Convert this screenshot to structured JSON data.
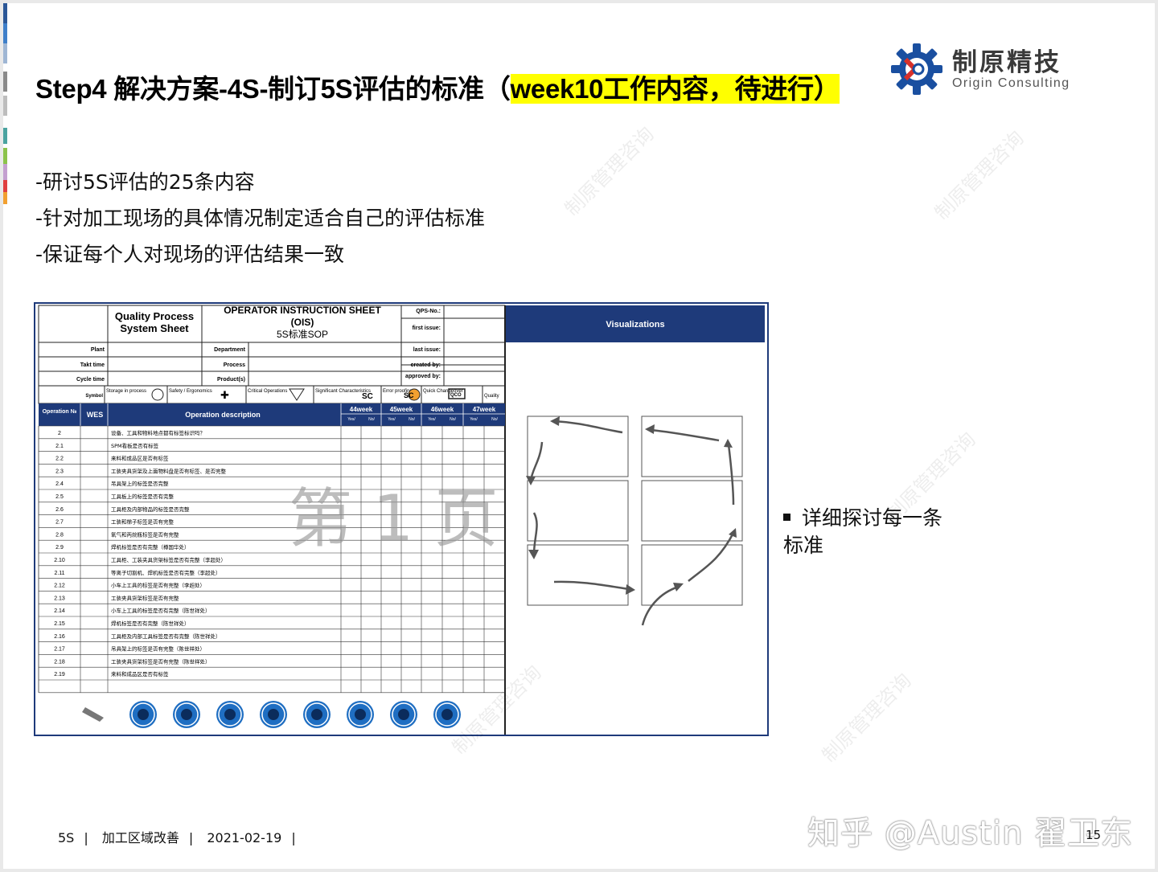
{
  "title": {
    "main": "Step4 解决方案-4S-制订5S评估的标准（",
    "highlight": "week10工作内容，待进行）"
  },
  "logo": {
    "cn": "制原精技",
    "en": "Origin Consulting"
  },
  "bullets": [
    "-研讨5S评估的25条内容",
    "-针对加工现场的具体情况制定适合自己的评估标准",
    "-保证每个人对现场的评估结果一致"
  ],
  "sheet": {
    "quality_process": "Quality Process",
    "system_sheet": "System Sheet",
    "ois_title": "OPERATOR INSTRUCTION SHEET",
    "ois_abbr": "(OIS)",
    "ois_sub": "5S标准SOP",
    "qps_no": "QPS-No.:",
    "first_issue": "first issue:",
    "last_issue": "last issue:",
    "created_by": "created by:",
    "approved_by": "approved by:",
    "plant": "Plant",
    "takt": "Takt time",
    "cycle": "Cycle time",
    "symbol": "Symbol",
    "department": "Department",
    "process": "Process",
    "products": "Product(s)",
    "visualizations": "Visualizations",
    "legend": [
      {
        "label": "Storage in process",
        "mark": "○"
      },
      {
        "label": "Safety / Ergonomics",
        "mark": "✚"
      },
      {
        "label": "Critical Operations",
        "mark": "▽"
      },
      {
        "label": "Significant Characteristics",
        "mark": "SC"
      },
      {
        "label": "Error proofing",
        "mark": "SC"
      },
      {
        "label": "Quick Changeover",
        "mark": "QCO"
      },
      {
        "label": "Quality",
        "mark": ""
      }
    ],
    "col_op": "Operation №",
    "col_wes": "WES",
    "col_desc": "Operation description",
    "weeks": [
      "44week",
      "45week",
      "46week",
      "47week"
    ],
    "yes": "Yes/",
    "no": "No/",
    "rows": [
      {
        "no": "2",
        "desc": "设备、工具和物料地点都有标签标识吗？"
      },
      {
        "no": "2.1",
        "desc": "SPM看板是否有标签"
      },
      {
        "no": "2.2",
        "desc": "来料和成品区是否有标签"
      },
      {
        "no": "2.3",
        "desc": "工装夹具货架及上面物料盘是否有标签、是否完整"
      },
      {
        "no": "2.4",
        "desc": "吊具架上的标签是否完整"
      },
      {
        "no": "2.5",
        "desc": "工具板上的标签是否有完整"
      },
      {
        "no": "2.6",
        "desc": "工具柜及内部物品的标签是否完整"
      },
      {
        "no": "2.7",
        "desc": "工装和梯子标签是否有完整"
      },
      {
        "no": "2.8",
        "desc": "氧气和丙烷瓶标签是否有完整"
      },
      {
        "no": "2.9",
        "desc": "焊机标签是否有完整（樽国华处）"
      },
      {
        "no": "2.10",
        "desc": "工具柜、工装夹具货架标签是否有完整（李超处）"
      },
      {
        "no": "2.11",
        "desc": "等离子切割机、焊机标签是否有完整（李超处）"
      },
      {
        "no": "2.12",
        "desc": "小车上工具的标签是否有完整（李超处）"
      },
      {
        "no": "2.13",
        "desc": "工装夹具货架标签是否有完整"
      },
      {
        "no": "2.14",
        "desc": "小车上工具的标签是否有完整（陈世祥处）"
      },
      {
        "no": "2.15",
        "desc": "焊机标签是否有完整（陈世祥处）"
      },
      {
        "no": "2.16",
        "desc": "工具柜及内部工具标签是否有完整（陈世祥处）"
      },
      {
        "no": "2.17",
        "desc": "吊具架上的标签是否有完整（陈世祥处）"
      },
      {
        "no": "2.18",
        "desc": "工装夹具货架标签是否有完整（陈世祥处）"
      },
      {
        "no": "2.19",
        "desc": "来料和成品区是否有标签"
      }
    ],
    "page_mark": "第 1 页"
  },
  "side_note": "详细探讨每一条标准",
  "footer": {
    "item1": "5S",
    "item2": "加工区域改善",
    "item3": "2021-02-19"
  },
  "page_number": "15",
  "zhihu_watermark": "知乎 @Austin 翟卫东",
  "watermark": "制原管理咨询",
  "colors": {
    "header_blue": "#1e3a7a",
    "icon_blue": "#1f6ec2",
    "highlight": "#ffff00",
    "logo_blue": "#1a4fa0"
  }
}
